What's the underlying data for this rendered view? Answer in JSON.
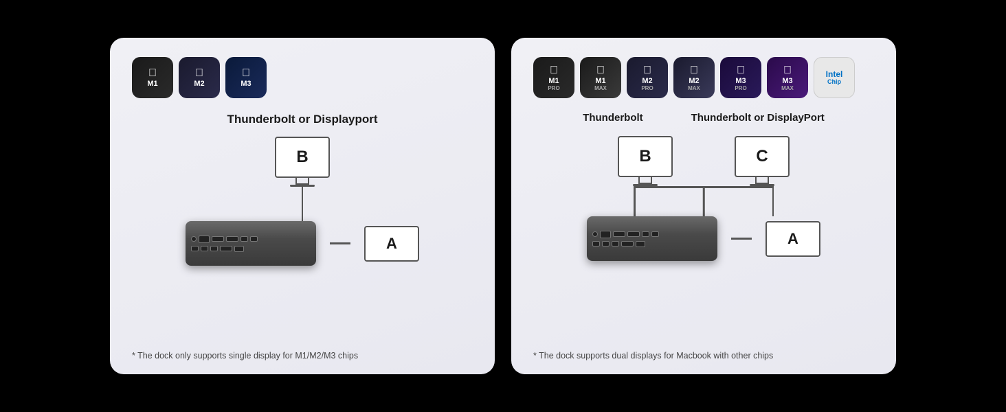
{
  "cards": [
    {
      "id": "card-single",
      "chips": [
        {
          "id": "m1",
          "label": "M1",
          "sub": "",
          "class": "m1"
        },
        {
          "id": "m2",
          "label": "M2",
          "sub": "",
          "class": "m2"
        },
        {
          "id": "m3",
          "label": "M3",
          "sub": "",
          "class": "m3"
        }
      ],
      "diagram_label": "Thunderbolt\nor Displayport",
      "monitor_b_label": "B",
      "laptop_a_label": "A",
      "footnote": "* The dock only supports single display for M1/M2/M3 chips"
    },
    {
      "id": "card-dual",
      "chips": [
        {
          "id": "m1pro",
          "label": "M1",
          "sub": "PRO",
          "class": "m1pro"
        },
        {
          "id": "m1max",
          "label": "M1",
          "sub": "MAX",
          "class": "m1max"
        },
        {
          "id": "m2pro",
          "label": "M2",
          "sub": "PRO",
          "class": "m2pro"
        },
        {
          "id": "m2max",
          "label": "M2",
          "sub": "MAX",
          "class": "m2max"
        },
        {
          "id": "m3pro",
          "label": "M3",
          "sub": "PRO",
          "class": "m3pro"
        },
        {
          "id": "m3max",
          "label": "M3",
          "sub": "MAX",
          "class": "m3max"
        },
        {
          "id": "intel",
          "label": "Intel",
          "sub": "Chip",
          "class": "intel"
        }
      ],
      "monitor_b_label": "B",
      "monitor_b_header": "Thunderbolt",
      "monitor_c_label": "C",
      "monitor_c_header": "Thunderbolt or DisplayPort",
      "laptop_a_label": "A",
      "footnote": "* The dock supports dual displays for Macbook with other chips"
    }
  ]
}
